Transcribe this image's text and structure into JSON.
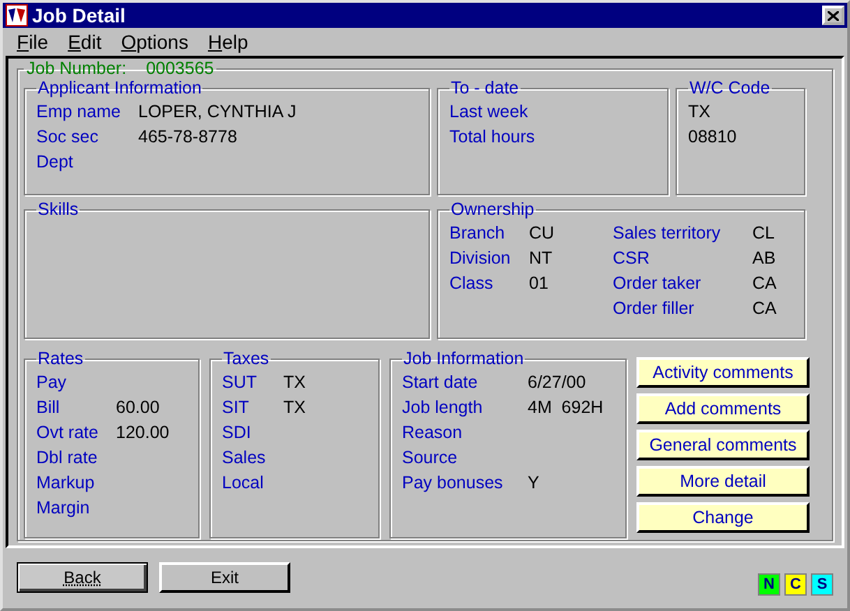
{
  "window": {
    "title": "Job Detail"
  },
  "menu": [
    "File",
    "Edit",
    "Options",
    "Help"
  ],
  "job_number": {
    "label": "Job Number:",
    "value": "0003565"
  },
  "applicant": {
    "title": "Applicant Information",
    "rows": [
      {
        "label": "Emp name",
        "value": "LOPER, CYNTHIA J"
      },
      {
        "label": "Soc sec",
        "value": "465-78-8778"
      },
      {
        "label": "Dept"
      }
    ]
  },
  "to_date": {
    "title": "To - date",
    "rows": [
      {
        "label": "Last week"
      },
      {
        "label": "Total hours"
      }
    ]
  },
  "wc_code": {
    "title": "W/C Code",
    "values": [
      "TX",
      "08810"
    ]
  },
  "skills": {
    "title": "Skills"
  },
  "ownership": {
    "title": "Ownership",
    "columns": [
      [
        {
          "label": "Branch",
          "value": "CU"
        },
        {
          "label": "Division",
          "value": "NT"
        },
        {
          "label": "Class",
          "value": "01"
        }
      ],
      [
        {
          "label": "Sales territory",
          "value": "CL"
        },
        {
          "label": "CSR",
          "value": "AB"
        },
        {
          "label": "Order taker",
          "value": "CA"
        },
        {
          "label": "Order filler",
          "value": "CA"
        }
      ]
    ]
  },
  "rates": {
    "title": "Rates",
    "rows": [
      {
        "label": "Pay"
      },
      {
        "label": "Bill",
        "value": "60.00"
      },
      {
        "label": "Ovt rate",
        "value": "120.00"
      },
      {
        "label": "Dbl rate"
      },
      {
        "label": "Markup"
      },
      {
        "label": "Margin"
      }
    ]
  },
  "taxes": {
    "title": "Taxes",
    "rows": [
      {
        "label": "SUT",
        "value": "TX"
      },
      {
        "label": "SIT",
        "value": "TX"
      },
      {
        "label": "SDI"
      },
      {
        "label": "Sales"
      },
      {
        "label": "Local"
      }
    ]
  },
  "job_information": {
    "title": "Job Information",
    "rows": [
      {
        "label": "Start date",
        "value": "6/27/00"
      },
      {
        "label": "Job length",
        "value": "4M  692H"
      },
      {
        "label": "Reason"
      },
      {
        "label": "Source"
      },
      {
        "label": "Pay bonuses",
        "value": "Y"
      }
    ]
  },
  "side_buttons": [
    "Activity comments",
    "Add comments",
    "General comments",
    "More detail",
    "Change"
  ],
  "bottom_buttons": [
    {
      "label": "Back",
      "selected": true
    },
    {
      "label": "Exit",
      "selected": false
    }
  ],
  "indicators": [
    {
      "label": "N",
      "color": "#00ff00"
    },
    {
      "label": "C",
      "color": "#ffff00"
    },
    {
      "label": "S",
      "color": "#00ffff"
    }
  ]
}
